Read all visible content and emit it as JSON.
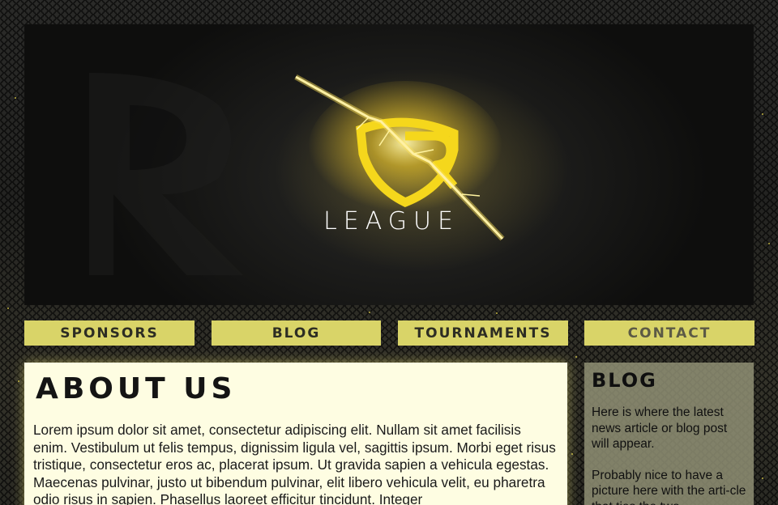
{
  "banner": {
    "logo_text": "LEAGUE",
    "accent_color": "#f5d71c"
  },
  "nav": {
    "items": [
      {
        "label": "SPONSORS"
      },
      {
        "label": "BLOG"
      },
      {
        "label": "TOURNAMENTS"
      },
      {
        "label": "CONTACT"
      }
    ]
  },
  "about": {
    "title": "ABOUT US",
    "body": "Lorem ipsum dolor sit amet, consectetur adipiscing elit. Nullam sit amet facilisis enim. Vestibulum ut felis tempus, dignissim ligula vel, sagittis ipsum. Morbi eget risus tristique, consectetur eros ac, placerat ipsum. Ut gravida sapien a vehicula egestas. Maecenas pulvinar, justo ut bibendum pulvinar, elit libero vehicula velit, eu pharetra odio risus in sapien. Phasellus laoreet efficitur tincidunt. Integer"
  },
  "blog": {
    "title": "BLOG",
    "paragraphs": [
      "Here is where the latest news article or blog post will appear.",
      "Probably nice to have a picture here with the arti-cle that ties the two"
    ]
  }
}
